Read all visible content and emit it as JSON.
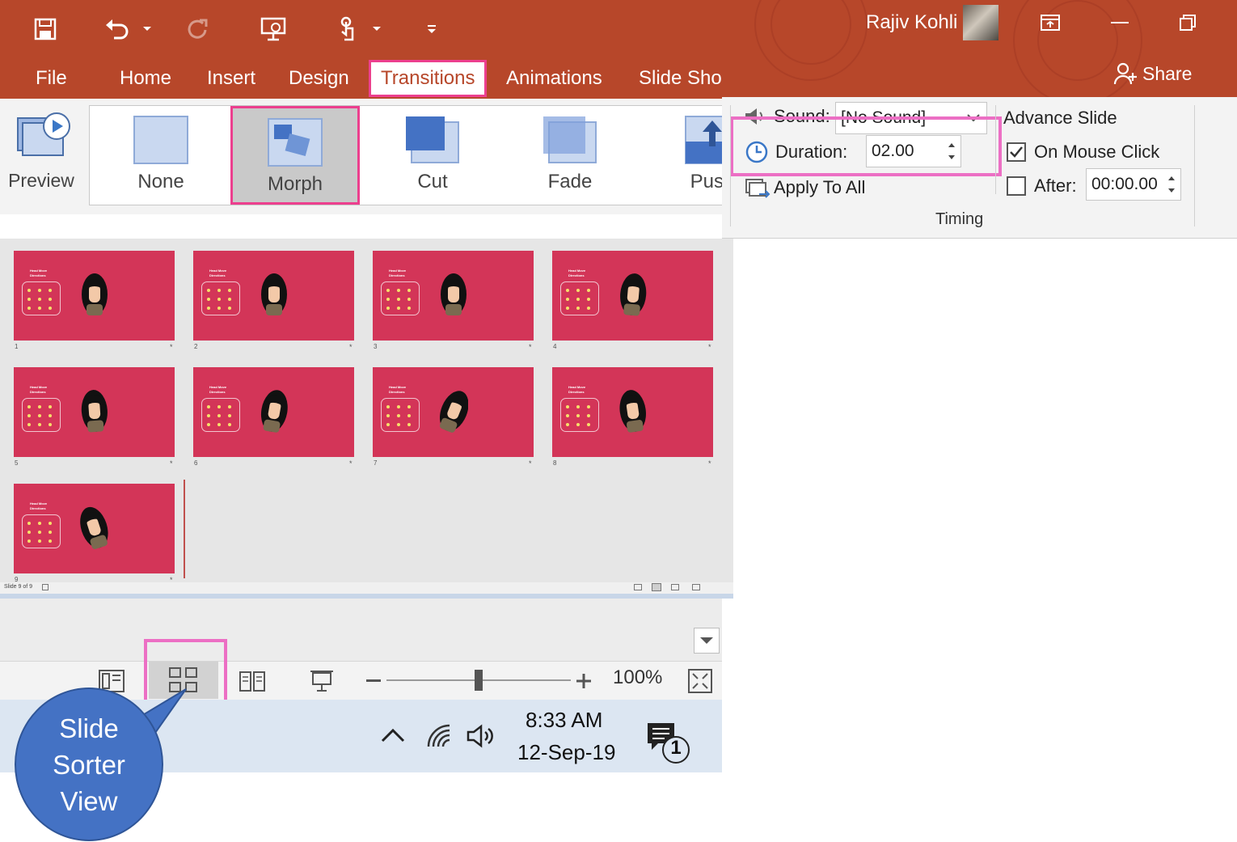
{
  "quick_access": {
    "save_icon": "save-icon",
    "undo_icon": "undo-icon",
    "redo_icon": "redo-icon",
    "present_icon": "present-from-start-icon",
    "touch_icon": "touch-mode-icon",
    "customize_icon": "customize-qat-icon"
  },
  "tabs": [
    {
      "label": "File"
    },
    {
      "label": "Home"
    },
    {
      "label": "Insert"
    },
    {
      "label": "Design"
    },
    {
      "label": "Transitions",
      "active": true
    },
    {
      "label": "Animations"
    },
    {
      "label": "Slide Sho"
    }
  ],
  "ribbon": {
    "preview_label": "Preview",
    "transitions": [
      {
        "label": "None"
      },
      {
        "label": "Morph",
        "selected": true
      },
      {
        "label": "Cut"
      },
      {
        "label": "Fade"
      },
      {
        "label": "Push"
      }
    ],
    "sound_label": "Sound:",
    "sound_value": "[No Sound]",
    "duration_label": "Duration:",
    "duration_value": "02.00",
    "apply_all_label": "Apply To All",
    "advance_slide_label": "Advance Slide",
    "on_mouse_click_label": "On Mouse Click",
    "on_mouse_click_checked": true,
    "after_label": "After:",
    "after_checked": false,
    "after_value": "00:00.00",
    "timing_group_label": "Timing"
  },
  "account": {
    "user_name": "Rajiv Kohli",
    "share_label": "Share"
  },
  "sorter": {
    "slide_title": "Head Move Directions",
    "slides": [
      {
        "number": "1"
      },
      {
        "number": "2"
      },
      {
        "number": "3"
      },
      {
        "number": "4"
      },
      {
        "number": "5"
      },
      {
        "number": "6"
      },
      {
        "number": "7"
      },
      {
        "number": "8"
      },
      {
        "number": "9"
      }
    ],
    "status_text": "Slide 9 of 9"
  },
  "statusbar": {
    "zoom_percent": "100%",
    "zoom_level": 0.5
  },
  "taskbar": {
    "time": "8:33 AM",
    "date": "12-Sep-19",
    "notification_count": "1"
  },
  "callout": {
    "line1": "Slide",
    "line2": "Sorter",
    "line3": "View"
  },
  "colors": {
    "accent": "#b7472a",
    "highlight": "#ec6fc4",
    "slide_bg": "#d33558",
    "callout": "#4472c4"
  }
}
